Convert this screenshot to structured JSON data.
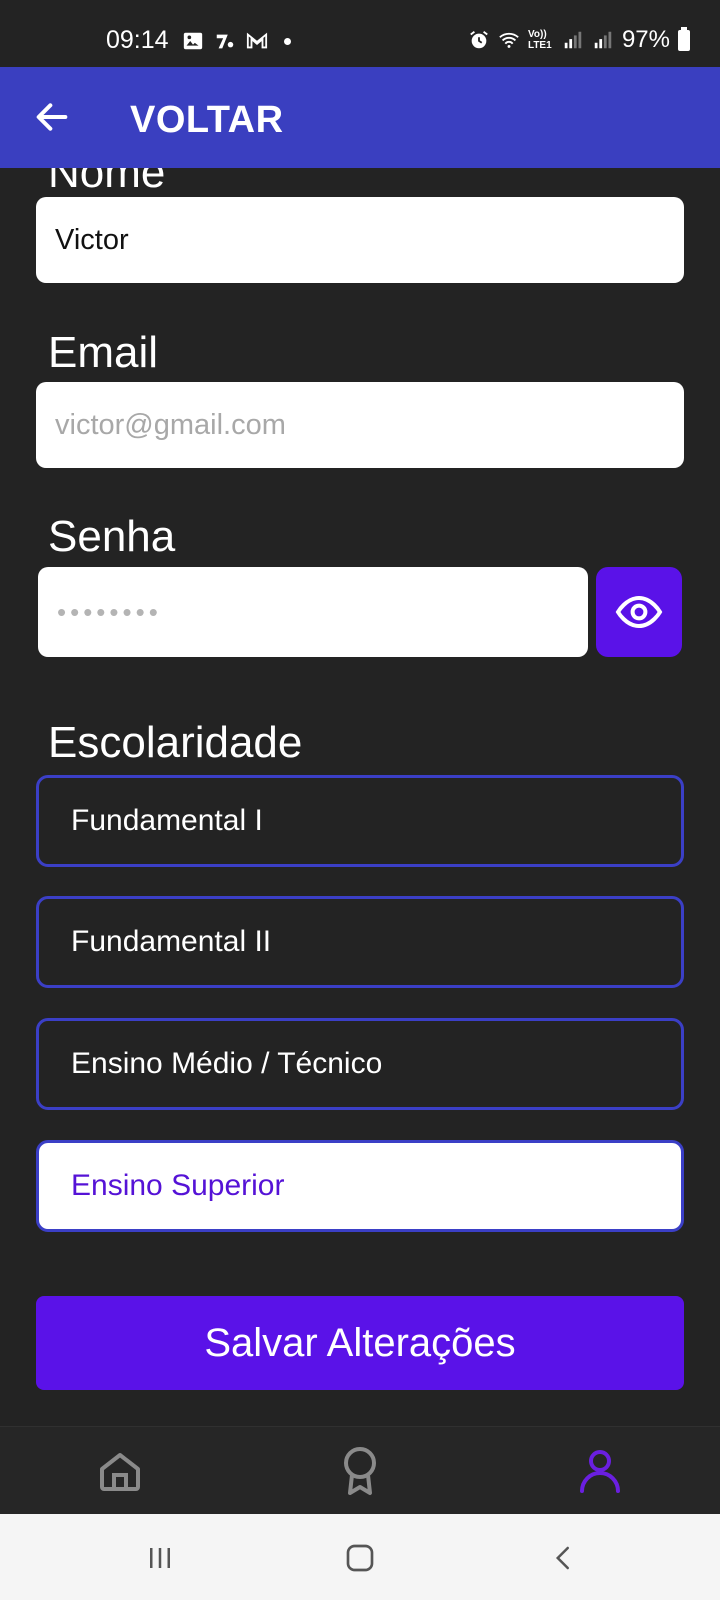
{
  "status_bar": {
    "time": "09:14",
    "network_label": "Vo)) LTE1",
    "battery": "97%",
    "icons": [
      "image-icon",
      "app-notification-icon",
      "gmail-icon",
      "dot-icon",
      "alarm-icon",
      "wifi-icon",
      "signal-icon",
      "signal-icon",
      "battery-icon"
    ]
  },
  "app_bar": {
    "back_icon": "arrow-left-icon",
    "title": "VOLTAR",
    "color": "#3a3fc0"
  },
  "form": {
    "name_label": "Nome",
    "name_value": "Victor",
    "email_label": "Email",
    "email_placeholder": "victor@gmail.com",
    "password_label": "Senha",
    "password_value": "••••••••",
    "password_toggle_icon": "eye-icon",
    "education_label": "Escolaridade",
    "education_options": [
      "Fundamental I",
      "Fundamental II",
      "Ensino Médio / Técnico",
      "Ensino Superior"
    ],
    "education_selected": "Ensino Superior",
    "save_label": "Salvar Alterações",
    "accent_color": "#5a12e8"
  },
  "bottom_nav": {
    "items": [
      {
        "icon": "home-icon",
        "active": false
      },
      {
        "icon": "award-icon",
        "active": false
      },
      {
        "icon": "profile-icon",
        "active": true
      }
    ],
    "active_color": "#6a1fe0"
  },
  "system_nav": {
    "icons": [
      "recents-icon",
      "home-button-icon",
      "back-icon"
    ]
  }
}
